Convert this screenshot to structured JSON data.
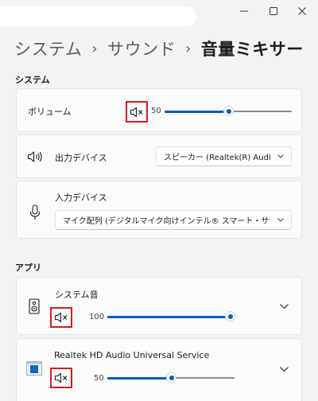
{
  "window": {
    "minimize_icon": "minimize-icon",
    "maximize_icon": "maximize-icon",
    "close_icon": "close-icon"
  },
  "breadcrumb": {
    "items": [
      "システム",
      "サウンド",
      "音量ミキサー"
    ],
    "separator": "›"
  },
  "system_section": {
    "label": "システム",
    "volume": {
      "label": "ボリューム",
      "muted_icon": "speaker-muted-icon",
      "value": "50",
      "level": 50,
      "max": 100
    },
    "output_device": {
      "icon": "speaker-icon",
      "label": "出力デバイス",
      "selected": "スピーカー (Realtek(R) Audio)"
    },
    "input_device": {
      "icon": "microphone-icon",
      "label": "入力デバイス",
      "selected": "マイク配列 (デジタルマイク向けインテル® スマート・サウンド・テクノロジー)"
    }
  },
  "apps_section": {
    "label": "アプリ",
    "apps": [
      {
        "name": "システム音",
        "icon": "system-sounds-icon",
        "muted_icon": "speaker-muted-icon",
        "value": "100",
        "level": 100,
        "expand_icon": "chevron-down-icon"
      },
      {
        "name": "Realtek HD Audio Universal Service",
        "icon": "realtek-app-icon",
        "muted_icon": "speaker-muted-icon",
        "value": "50",
        "level": 50,
        "expand_icon": "chevron-down-icon"
      }
    ]
  },
  "colors": {
    "accent": "#005fb8",
    "highlight_box": "#e0181b",
    "background": "#f3f3f3",
    "card": "#fbfbfb"
  }
}
